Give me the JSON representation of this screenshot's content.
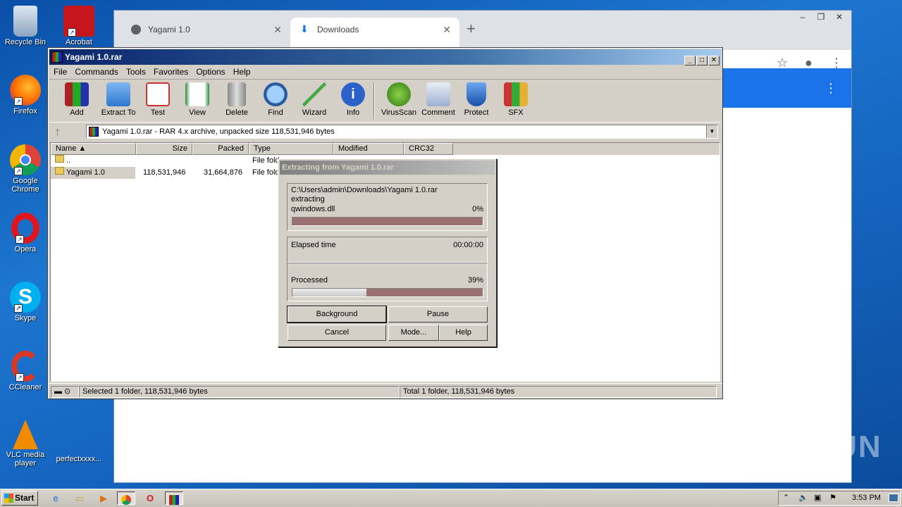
{
  "desktop": {
    "icons": [
      {
        "label": "Recycle Bin",
        "icon": "recycle-bin"
      },
      {
        "label": "Firefox",
        "icon": "firefox"
      },
      {
        "label": "Google Chrome",
        "icon": "chrome"
      },
      {
        "label": "Opera",
        "icon": "opera"
      },
      {
        "label": "Skype",
        "icon": "skype"
      },
      {
        "label": "CCleaner",
        "icon": "ccleaner"
      },
      {
        "label": "VLC media player",
        "icon": "vlc"
      }
    ],
    "acrobat_label": "Acrobat",
    "extra_icon_label": "perfectxxxx...",
    "watermark": "ANY RUN"
  },
  "browser": {
    "tabs": [
      {
        "label": "Yagami 1.0",
        "active": false
      },
      {
        "label": "Downloads",
        "active": true
      }
    ],
    "new_tab": "+"
  },
  "winrar": {
    "title": "Yagami 1.0.rar",
    "menu": [
      "File",
      "Commands",
      "Tools",
      "Favorites",
      "Options",
      "Help"
    ],
    "toolbar": [
      "Add",
      "Extract To",
      "Test",
      "View",
      "Delete",
      "Find",
      "Wizard",
      "Info",
      "VirusScan",
      "Comment",
      "Protect",
      "SFX"
    ],
    "address": "Yagami 1.0.rar - RAR 4.x archive, unpacked size 118,531,946 bytes",
    "columns": [
      "Name",
      "Size",
      "Packed",
      "Type",
      "Modified",
      "CRC32"
    ],
    "rows": [
      {
        "name": "..",
        "size": "",
        "packed": "",
        "type": "File fold"
      },
      {
        "name": "Yagami 1.0",
        "size": "118,531,946",
        "packed": "31,664,876",
        "type": "File fold"
      }
    ],
    "status_left": "Selected 1 folder, 118,531,946 bytes",
    "status_right": "Total 1 folder, 118,531,946 bytes"
  },
  "dialog": {
    "title": "Extracting from Yagami 1.0.rar",
    "path": "C:\\Users\\admin\\Downloads\\Yagami 1.0.rar",
    "action": "extracting",
    "file": "qwindows.dll",
    "file_percent": "0%",
    "file_progress": 0,
    "elapsed_label": "Elapsed time",
    "elapsed_value": "00:00:00",
    "processed_label": "Processed",
    "processed_percent": "39%",
    "processed_progress": 0.39,
    "buttons": {
      "background": "Background",
      "pause": "Pause",
      "cancel": "Cancel",
      "mode": "Mode...",
      "help": "Help"
    }
  },
  "taskbar": {
    "start": "Start",
    "clock": "3:53 PM"
  }
}
